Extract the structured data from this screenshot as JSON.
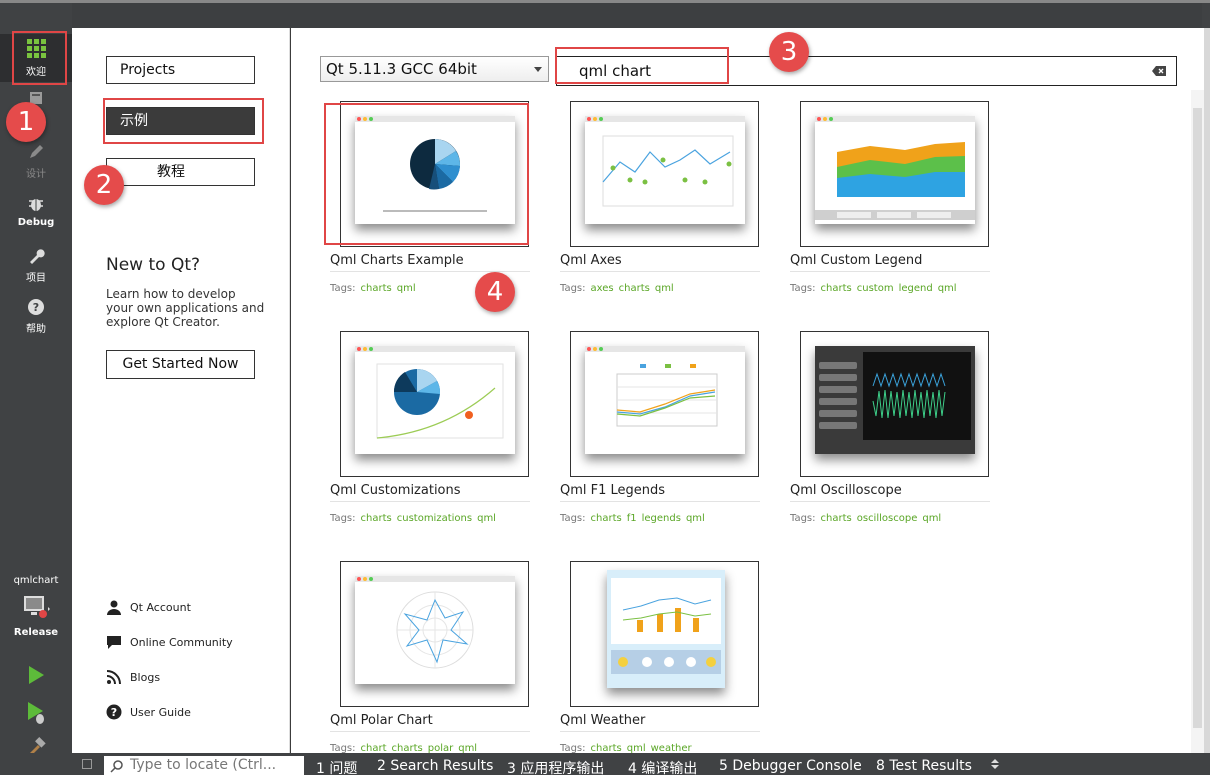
{
  "modebar": {
    "welcome": "欢迎",
    "design": "设计",
    "debug": "Debug",
    "projects": "项目",
    "help": "帮助",
    "kit_name": "qmlchart",
    "build_config": "Release"
  },
  "sidebar": {
    "projects_button": "Projects",
    "examples_button": "示例",
    "tutorials_button": "教程",
    "new_title": "New to Qt?",
    "new_desc": "Learn how to develop your own applications and explore Qt Creator.",
    "get_started": "Get Started Now",
    "links": [
      "Qt Account",
      "Online Community",
      "Blogs",
      "User Guide"
    ]
  },
  "main": {
    "qt_version": "Qt 5.11.3 GCC 64bit",
    "search_value": "qml chart",
    "tags_label": "Tags:"
  },
  "examples": [
    {
      "title": "Qml Charts Example",
      "tags": [
        "charts",
        "qml"
      ]
    },
    {
      "title": "Qml Axes",
      "tags": [
        "axes",
        "charts",
        "qml"
      ]
    },
    {
      "title": "Qml Custom Legend",
      "tags": [
        "charts",
        "custom",
        "legend",
        "qml"
      ]
    },
    {
      "title": "Qml Customizations",
      "tags": [
        "charts",
        "customizations",
        "qml"
      ]
    },
    {
      "title": "Qml F1 Legends",
      "tags": [
        "charts",
        "f1",
        "legends",
        "qml"
      ]
    },
    {
      "title": "Qml Oscilloscope",
      "tags": [
        "charts",
        "oscilloscope",
        "qml"
      ]
    },
    {
      "title": "Qml Polar Chart",
      "tags": [
        "chart",
        "charts",
        "polar",
        "qml"
      ]
    },
    {
      "title": "Qml Weather",
      "tags": [
        "charts",
        "qml",
        "weather"
      ]
    }
  ],
  "statusbar": {
    "locate_placeholder": "Type to locate (Ctrl...",
    "tabs": [
      "1 问题",
      "2 Search Results",
      "3 应用程序输出",
      "4 编译输出",
      "5 Debugger Console",
      "8 Test Results"
    ]
  },
  "annotations": [
    "1",
    "2",
    "3",
    "4"
  ],
  "colors": {
    "accent_green": "#5aa626",
    "annotation_red": "#e04646",
    "dark_sidebar": "#404244"
  }
}
